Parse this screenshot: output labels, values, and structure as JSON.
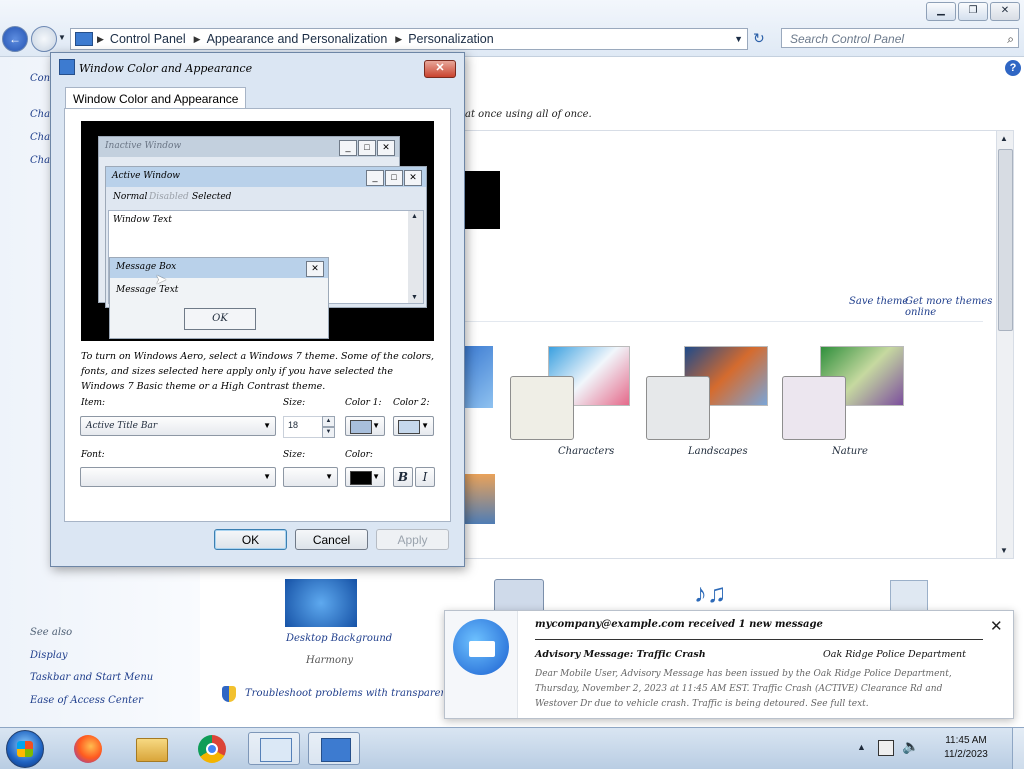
{
  "explorer": {
    "breadcrumb": [
      "Control Panel",
      "Appearance and Personalization",
      "Personalization"
    ],
    "search_placeholder": "Search Control Panel",
    "right_intro": "at once using all of once.",
    "links": {
      "save_theme": "Save theme",
      "more_themes": "Get more themes online"
    },
    "themes": [
      "Characters",
      "Landscapes",
      "Nature"
    ],
    "bottom_items": {
      "desktop_background": "Desktop Background",
      "desktop_background_sub": "Harmony"
    },
    "troubleshoot": "Troubleshoot problems with transparency and other Aero effects"
  },
  "leftnav": {
    "top_items": [
      "Control",
      "Change",
      "Change",
      "Change"
    ],
    "see_also_title": "See also",
    "see_also": [
      "Display",
      "Taskbar and Start Menu",
      "Ease of Access Center"
    ]
  },
  "dialog": {
    "title": "Window Color and Appearance",
    "tab": "Window Color and Appearance",
    "preview": {
      "inactive_title": "Inactive Window",
      "active_title": "Active Window",
      "menu": [
        "Normal",
        "Disabled",
        "Selected"
      ],
      "window_text": "Window Text",
      "msg_title": "Message Box",
      "msg_text": "Message Text",
      "ok": "OK"
    },
    "description": "To turn on Windows Aero, select a Windows 7 theme. Some of the colors, fonts, and sizes selected here apply only if you have selected the Windows 7 Basic theme or a High Contrast theme.",
    "item_label": "Item:",
    "item_value": "Active Title Bar",
    "size_label": "Size:",
    "size_value": "18",
    "color1_label": "Color 1:",
    "color2_label": "Color 2:",
    "font_label": "Font:",
    "font_size_label": "Size:",
    "font_color_label": "Color:",
    "bold_glyph": "B",
    "italic_glyph": "I",
    "ok": "OK",
    "cancel": "Cancel",
    "apply": "Apply"
  },
  "notification": {
    "header": "mycompany@example.com received 1 new message",
    "subject": "Advisory Message: Traffic Crash",
    "sender": "Oak Ridge Police Department",
    "body": "Dear Mobile User, Advisory Message has been issued by the Oak Ridge Police Department, Thursday, November 2, 2023 at 11:45 AM EST. Traffic Crash (ACTIVE) Clearance Rd and Westover Dr due to vehicle crash. Traffic is being detoured. See full text."
  },
  "taskbar": {
    "time": "11:45 AM",
    "date": "11/2/2023"
  },
  "colors": {
    "accent": "#2453b2",
    "title_active": "#b9d1ea",
    "swatch_color1": "#a8bfdc",
    "swatch_color2": "#c6d8ec"
  }
}
